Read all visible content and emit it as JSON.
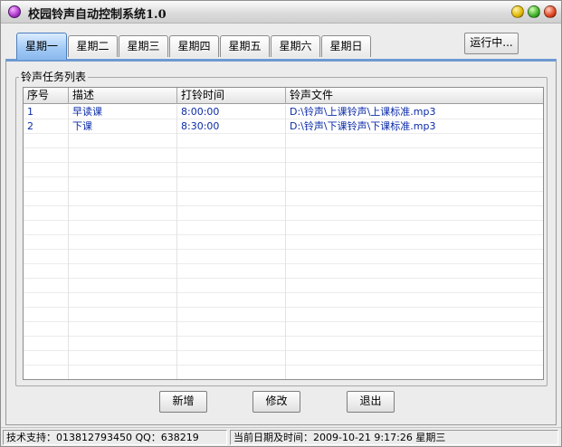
{
  "window": {
    "title": "校园铃声自动控制系统1.0"
  },
  "tabs": [
    {
      "label": "星期一",
      "active": true
    },
    {
      "label": "星期二",
      "active": false
    },
    {
      "label": "星期三",
      "active": false
    },
    {
      "label": "星期四",
      "active": false
    },
    {
      "label": "星期五",
      "active": false
    },
    {
      "label": "星期六",
      "active": false
    },
    {
      "label": "星期日",
      "active": false
    }
  ],
  "run_button": "运行中...",
  "group": {
    "title": "铃声任务列表",
    "columns": [
      "序号",
      "描述",
      "打铃时间",
      "铃声文件"
    ],
    "rows": [
      {
        "index": "1",
        "desc": "早读课",
        "time": "8:00:00",
        "file": "D:\\铃声\\上课铃声\\上课标准.mp3"
      },
      {
        "index": "2",
        "desc": "下课",
        "time": "8:30:00",
        "file": "D:\\铃声\\下课铃声\\下课标准.mp3"
      }
    ]
  },
  "buttons": {
    "add": "新增",
    "edit": "修改",
    "exit": "退出"
  },
  "status": {
    "support": "技术支持：013812793450   QQ：638219",
    "datetime": "当前日期及时间：2009-10-21  9:17:26  星期三"
  },
  "colors": {
    "row_text": "#0b2ba8",
    "active_tab": "#9fc8f4",
    "panel_accent": "#6d9ad2"
  },
  "icons": {
    "app": "purple-orb-icon",
    "minimize": "yellow-orb-icon",
    "maximize": "green-orb-icon",
    "close": "red-orb-icon"
  }
}
